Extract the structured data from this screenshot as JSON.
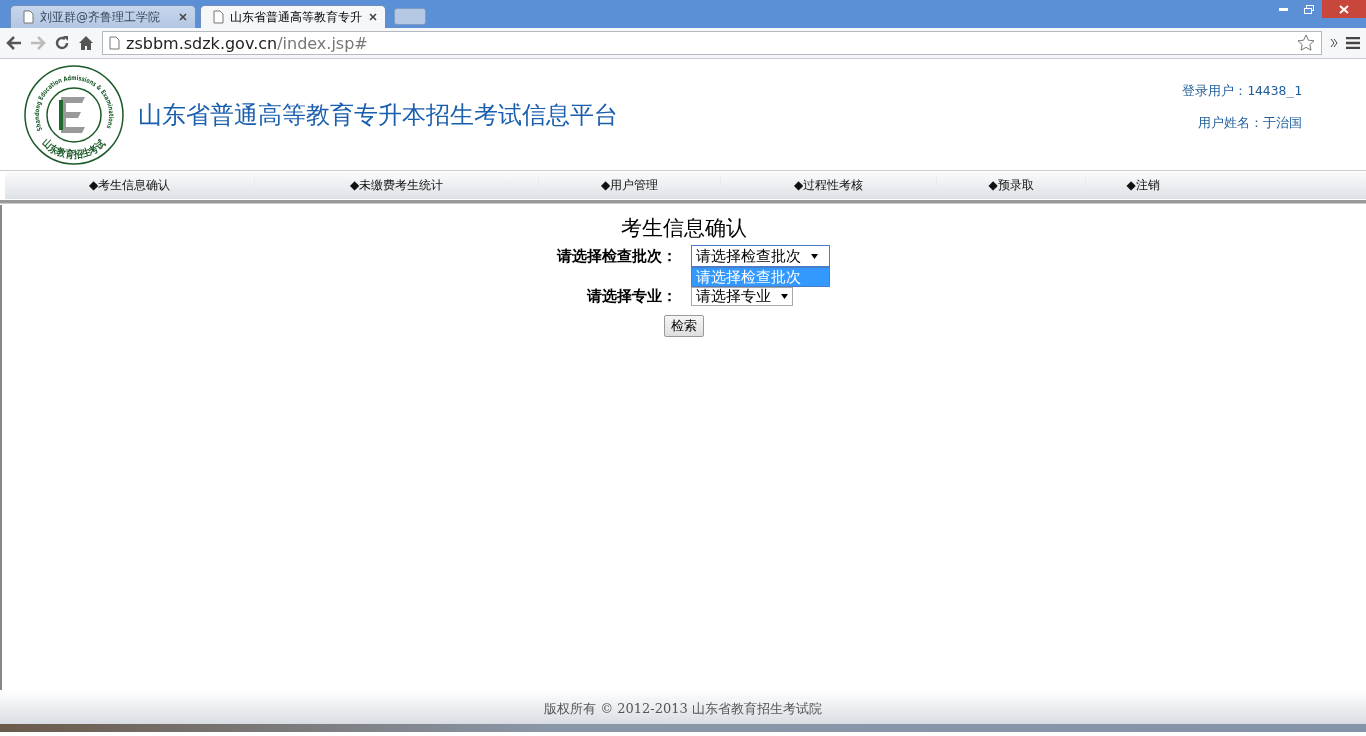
{
  "browser": {
    "tabs": [
      {
        "title": "刘亚群@齐鲁理工学院",
        "selected": false
      },
      {
        "title": "山东省普通高等教育专升",
        "selected": true
      }
    ],
    "address": {
      "host": "zsbbm.sdzk.gov.cn",
      "path": "/index.jsp#"
    }
  },
  "header": {
    "logo": {
      "ring_text": "Shandong Education Admissions & Examinations",
      "bottom_text": "山东教育招生考试"
    },
    "title": "山东省普通高等教育专升本招生考试信息平台",
    "user": [
      {
        "label": "登录用户：14438_1"
      },
      {
        "label": "用户姓名：于治国"
      }
    ]
  },
  "nav": [
    {
      "label": "◆考生信息确认"
    },
    {
      "label": "◆未缴费考生统计"
    },
    {
      "label": "◆用户管理"
    },
    {
      "label": "◆过程性考核"
    },
    {
      "label": "◆预录取"
    },
    {
      "label": "◆注销"
    }
  ],
  "form": {
    "heading": "考生信息确认",
    "fields": [
      {
        "label": "请选择检查批次：",
        "value": "请选择检查批次",
        "expanded": true,
        "options": [
          {
            "label": "请选择检查批次",
            "selected": true
          }
        ]
      },
      {
        "label": "请选择专业：",
        "value": "请选择专业",
        "expanded": false
      }
    ],
    "button": "检索"
  },
  "footer": {
    "text": "版权所有 © 2012-2013 山东省教育招生考试院"
  }
}
